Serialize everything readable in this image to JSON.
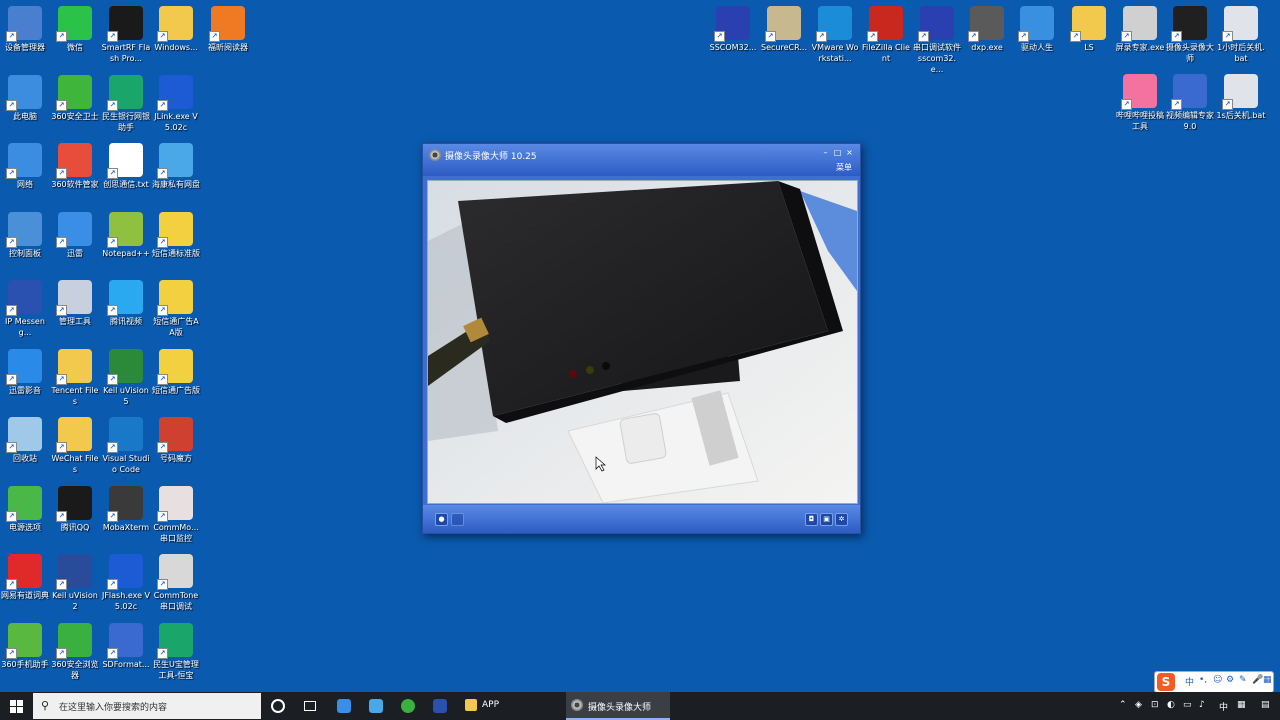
{
  "desktop_icons_left": [
    {
      "label": "设备管理器",
      "icon": "device-manager-icon",
      "color": "#4a7fd0"
    },
    {
      "label": "微信",
      "icon": "wechat-icon",
      "color": "#2bc24a"
    },
    {
      "label": "SmartRF Flash Pro...",
      "icon": "smartrf-icon",
      "color": "#1a1a1a"
    },
    {
      "label": "Windows...",
      "icon": "folder-icon",
      "color": "#f2c94c"
    },
    {
      "label": "福昕阅读器",
      "icon": "pdf-reader-icon",
      "color": "#f07a24"
    },
    {
      "label": "此电脑",
      "icon": "this-pc-icon",
      "color": "#3c8ce0"
    },
    {
      "label": "360安全卫士",
      "icon": "360-safe-icon",
      "color": "#3fb53c"
    },
    {
      "label": "民生银行网银助手",
      "icon": "bank-assistant-icon",
      "color": "#1aa56a"
    },
    {
      "label": "JLink.exe V5.02c",
      "icon": "jlink-icon",
      "color": "#1c5bd4"
    },
    {
      "label": "网络",
      "icon": "network-icon",
      "color": "#3a8de0"
    },
    {
      "label": "360软件管家",
      "icon": "360-software-icon",
      "color": "#e84d3c"
    },
    {
      "label": "创思通信.txt",
      "icon": "text-file-icon",
      "color": "#ffffff"
    },
    {
      "label": "海康私有网盘",
      "icon": "cloud-drive-icon",
      "color": "#4aa8e8"
    },
    {
      "label": "控制面板",
      "icon": "control-panel-icon",
      "color": "#4a90d9"
    },
    {
      "label": "迅雷",
      "icon": "xunlei-icon",
      "color": "#3a8ee6"
    },
    {
      "label": "Notepad++",
      "icon": "notepadpp-icon",
      "color": "#90c040"
    },
    {
      "label": "短信通标准版",
      "icon": "sms-standard-icon",
      "color": "#f2d040"
    },
    {
      "label": "IP Messeng...",
      "icon": "ip-messenger-icon",
      "color": "#2a50b0"
    },
    {
      "label": "管理工具",
      "icon": "admin-tools-icon",
      "color": "#c8d0e0"
    },
    {
      "label": "腾讯视频",
      "icon": "tencent-video-icon",
      "color": "#2aa8f0"
    },
    {
      "label": "短信通广告AA版",
      "icon": "sms-ad-aa-icon",
      "color": "#f2d040"
    },
    {
      "label": "迅雷影音",
      "icon": "xunlei-player-icon",
      "color": "#2a8ae8"
    },
    {
      "label": "Tencent Files",
      "icon": "folder-icon",
      "color": "#f2c94c"
    },
    {
      "label": "Keil uVision5",
      "icon": "keil-uvision5-icon",
      "color": "#2a8a3a"
    },
    {
      "label": "短信通广告版",
      "icon": "sms-ad-icon",
      "color": "#f2d040"
    },
    {
      "label": "回收站",
      "icon": "recycle-bin-icon",
      "color": "#a0c8e8"
    },
    {
      "label": "WeChat Files",
      "icon": "folder-icon",
      "color": "#f2c94c"
    },
    {
      "label": "Visual Studio Code",
      "icon": "vscode-icon",
      "color": "#1a78c8"
    },
    {
      "label": "号码魔方",
      "icon": "number-cube-icon",
      "color": "#d04030"
    },
    {
      "label": "电源选项",
      "icon": "power-options-icon",
      "color": "#4ab848"
    },
    {
      "label": "腾讯QQ",
      "icon": "qq-icon",
      "color": "#1a1a1a"
    },
    {
      "label": "MobaXterm",
      "icon": "mobaxterm-icon",
      "color": "#3a3a3a"
    },
    {
      "label": "CommMo... 串口监控",
      "icon": "commmonitor-icon",
      "color": "#e8e0e0"
    },
    {
      "label": "网易有道词典",
      "icon": "youdao-icon",
      "color": "#e02a2a"
    },
    {
      "label": "Keil uVision2",
      "icon": "keil-uvision2-icon",
      "color": "#2a4a9a"
    },
    {
      "label": "JFlash.exe V5.02c",
      "icon": "jflash-icon",
      "color": "#1c5bd4"
    },
    {
      "label": "CommTone 串口调试",
      "icon": "commtone-icon",
      "color": "#d8d8d8"
    },
    {
      "label": "360手机助手",
      "icon": "360-phone-icon",
      "color": "#58b840"
    },
    {
      "label": "360安全浏览器",
      "icon": "360-browser-icon",
      "color": "#3ab040"
    },
    {
      "label": "SDFormat...",
      "icon": "sdformatter-icon",
      "color": "#3a6ad0"
    },
    {
      "label": "民生U宝管理工具-恒宝",
      "icon": "ukey-tool-icon",
      "color": "#1aa56a"
    }
  ],
  "desktop_icons_right": [
    {
      "label": "SSCOM32...",
      "icon": "sscom-icon",
      "color": "#2a40b0"
    },
    {
      "label": "SecureCR...",
      "icon": "securecrt-icon",
      "color": "#c8b890"
    },
    {
      "label": "VMware Workstati...",
      "icon": "vmware-icon",
      "color": "#1a8cd8"
    },
    {
      "label": "FileZilla Client",
      "icon": "filezilla-icon",
      "color": "#c8281e"
    },
    {
      "label": "串口调试软件 sscom32.e...",
      "icon": "serial-debug-icon",
      "color": "#2a40b0"
    },
    {
      "label": "dxp.exe",
      "icon": "dxp-icon",
      "color": "#5a5a5a"
    },
    {
      "label": "驱动人生",
      "icon": "driver-life-icon",
      "color": "#3a90e0"
    },
    {
      "label": "LS",
      "icon": "folder-icon",
      "color": "#f2c94c"
    },
    {
      "label": "屏录专家.exe",
      "icon": "screen-recorder-icon",
      "color": "#d0d0d0"
    },
    {
      "label": "摄像头录像大师",
      "icon": "camera-recorder-icon",
      "color": "#202020"
    },
    {
      "label": "1小时后关机.bat",
      "icon": "bat-file-icon",
      "color": "#e0e4ea"
    },
    {
      "label": "哔哩哔哩投稿工具",
      "icon": "bilibili-icon",
      "color": "#f472a0"
    },
    {
      "label": "视频编辑专家 9.0",
      "icon": "video-editor-icon",
      "color": "#3a6ad0"
    },
    {
      "label": "1s后关机.bat",
      "icon": "bat-file-icon",
      "color": "#e0e4ea"
    }
  ],
  "camera_window": {
    "title": "摄像头录像大师 10.25",
    "menu": "菜单",
    "btn_min": "–",
    "btn_max": "□",
    "btn_close": "×"
  },
  "taskbar": {
    "search_placeholder": "在这里输入你要搜索的内容",
    "tasks": [
      {
        "label": "APP",
        "icon": "folder-icon"
      },
      {
        "label": "摄像头录像大师",
        "icon": "camera-recorder-icon"
      }
    ],
    "tray_lang": "中"
  },
  "ime": {
    "mode": "中"
  }
}
